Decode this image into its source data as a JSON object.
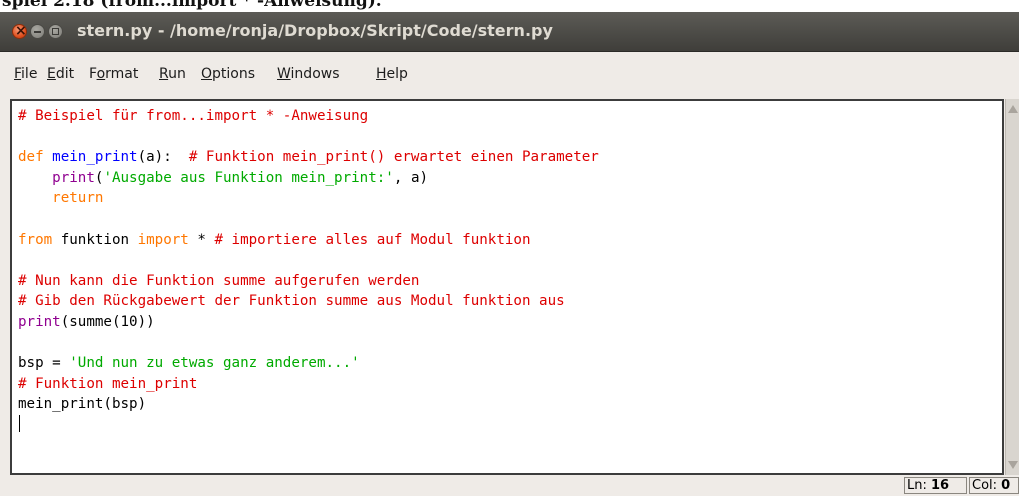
{
  "page_caption": "spiel 2.18 (from...import * -Anweisung).",
  "window": {
    "title": "stern.py - /home/ronja/Dropbox/Skript/Code/stern.py"
  },
  "menu": [
    {
      "mnemonic": "F",
      "rest": "ile"
    },
    {
      "mnemonic": "E",
      "rest": "dit"
    },
    {
      "pre": "F",
      "mnemonic": "o",
      "rest": "rmat"
    },
    {
      "mnemonic": "R",
      "rest": "un"
    },
    {
      "mnemonic": "O",
      "rest": "ptions"
    },
    {
      "mnemonic": "W",
      "rest": "indows"
    },
    {
      "mnemonic": "H",
      "rest": "elp"
    }
  ],
  "code_lines": [
    [
      {
        "t": "# Beispiel für from...import * -Anweisung",
        "c": "cm"
      }
    ],
    [],
    [
      {
        "t": "def",
        "c": "kw"
      },
      {
        "t": " "
      },
      {
        "t": "mein_print",
        "c": "df"
      },
      {
        "t": "(a):  "
      },
      {
        "t": "# Funktion mein_print() erwartet einen Parameter",
        "c": "cm"
      }
    ],
    [
      {
        "t": "    "
      },
      {
        "t": "print",
        "c": "bi"
      },
      {
        "t": "("
      },
      {
        "t": "'Ausgabe aus Funktion mein_print:'",
        "c": "st"
      },
      {
        "t": ", a)"
      }
    ],
    [
      {
        "t": "    "
      },
      {
        "t": "return",
        "c": "kw"
      }
    ],
    [],
    [
      {
        "t": "from",
        "c": "kw"
      },
      {
        "t": " funktion "
      },
      {
        "t": "import",
        "c": "kw"
      },
      {
        "t": " * "
      },
      {
        "t": "# importiere alles auf Modul funktion",
        "c": "cm"
      }
    ],
    [],
    [
      {
        "t": "# Nun kann die Funktion summe aufgerufen werden",
        "c": "cm"
      }
    ],
    [
      {
        "t": "# Gib den Rückgabewert der Funktion summe aus Modul funktion aus",
        "c": "cm"
      }
    ],
    [
      {
        "t": "print",
        "c": "bi"
      },
      {
        "t": "(summe(10))"
      }
    ],
    [],
    [
      {
        "t": "bsp = "
      },
      {
        "t": "'Und nun zu etwas ganz anderem...'",
        "c": "st"
      }
    ],
    [
      {
        "t": "# Funktion mein_print",
        "c": "cm"
      }
    ],
    [
      {
        "t": "mein_print(bsp)"
      }
    ],
    []
  ],
  "status": {
    "line_label": "Ln: ",
    "line": "16",
    "col_label": "Col: ",
    "col": "0"
  }
}
